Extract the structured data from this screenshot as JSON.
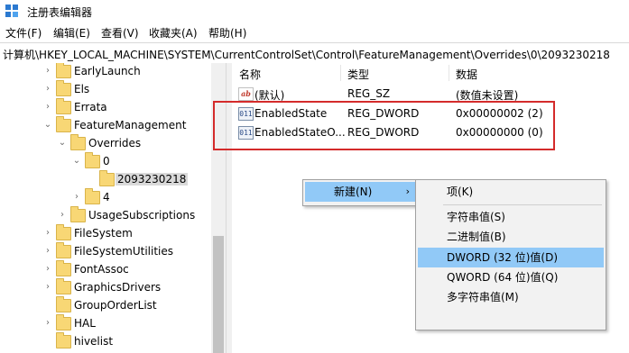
{
  "window": {
    "title": "注册表编辑器"
  },
  "menu": [
    "文件(F)",
    "编辑(E)",
    "查看(V)",
    "收藏夹(A)",
    "帮助(H)"
  ],
  "address": "计算机\\HKEY_LOCAL_MACHINE\\SYSTEM\\CurrentControlSet\\Control\\FeatureManagement\\Overrides\\0\\2093230218",
  "tree": [
    {
      "label": "EarlyLaunch",
      "arrow": "›"
    },
    {
      "label": "Els",
      "arrow": "›"
    },
    {
      "label": "Errata",
      "arrow": "›"
    },
    {
      "label": "FeatureManagement",
      "arrow": "⌄"
    },
    {
      "label": "Overrides",
      "arrow": "⌄"
    },
    {
      "label": "0",
      "arrow": "⌄"
    },
    {
      "label": "2093230218",
      "arrow": ""
    },
    {
      "label": "4",
      "arrow": "›"
    },
    {
      "label": "UsageSubscriptions",
      "arrow": "›"
    },
    {
      "label": "FileSystem",
      "arrow": "›"
    },
    {
      "label": "FileSystemUtilities",
      "arrow": "›"
    },
    {
      "label": "FontAssoc",
      "arrow": "›"
    },
    {
      "label": "GraphicsDrivers",
      "arrow": "›"
    },
    {
      "label": "GroupOrderList",
      "arrow": ""
    },
    {
      "label": "HAL",
      "arrow": "›"
    },
    {
      "label": "hivelist",
      "arrow": ""
    }
  ],
  "columns": [
    "名称",
    "类型",
    "数据"
  ],
  "values": [
    {
      "name": "(默认)",
      "type": "REG_SZ",
      "data": "(数值未设置)",
      "icon": "ab"
    },
    {
      "name": "EnabledState",
      "type": "REG_DWORD",
      "data": "0x00000002 (2)",
      "icon": "011"
    },
    {
      "name": "EnabledStateO...",
      "type": "REG_DWORD",
      "data": "0x00000000 (0)",
      "icon": "011"
    }
  ],
  "context_menu": {
    "new_label": "新建(N)",
    "submenu_arrow": "›"
  },
  "submenu": {
    "items": [
      "项(K)",
      "字符串值(S)",
      "二进制值(B)",
      "DWORD (32 位)值(D)",
      "QWORD (64 位)值(Q)",
      "多字符串值(M)"
    ],
    "highlighted": "DWORD (32 位)值(D)"
  }
}
